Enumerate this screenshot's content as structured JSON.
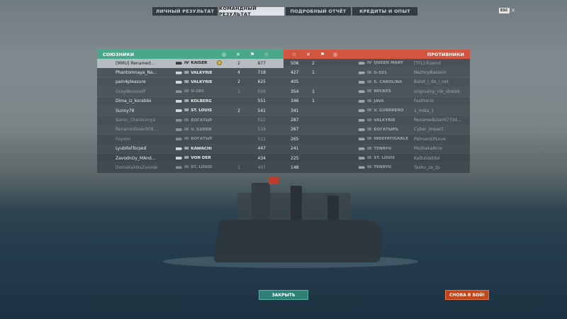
{
  "tabs": [
    {
      "label": "ЛИЧНЫЙ РЕЗУЛЬТАТ"
    },
    {
      "label": "КОМАНДНЫЙ РЕЗУЛЬТАТ"
    },
    {
      "label": "ПОДРОБНЫЙ ОТЧЁТ"
    },
    {
      "label": "КРЕДИТЫ И ОПЫТ"
    }
  ],
  "active_tab": "КОМАНДНЫЙ РЕЗУЛЬТАТ",
  "hotkey": {
    "key": "ESC",
    "close": "×"
  },
  "allies": {
    "title": "СОЮЗНИКИ",
    "header_icons": {
      "medal": "◎",
      "kills": "✕",
      "capture": "⚑",
      "score": "☆"
    },
    "rows": [
      {
        "name": "[MMU] RenamedUser...",
        "tier": "IV",
        "ship": "KAISER",
        "medal": true,
        "kills": "2",
        "cap": "",
        "score": "877",
        "self": true,
        "alive": true
      },
      {
        "name": "Phantomnaya_Nastya",
        "tier": "III",
        "ship": "VALKYRIE",
        "medal": false,
        "kills": "4",
        "cap": "",
        "score": "718",
        "self": false,
        "alive": true
      },
      {
        "name": "pain4pleasure",
        "tier": "III",
        "ship": "VALKYRIE",
        "medal": false,
        "kills": "2",
        "cap": "",
        "score": "625",
        "self": false,
        "alive": true
      },
      {
        "name": "GrayWooooolf",
        "tier": "III",
        "ship": "G-101",
        "medal": false,
        "kills": "1",
        "cap": "",
        "score": "556",
        "self": false,
        "alive": false
      },
      {
        "name": "Dima_iz_korablei",
        "tier": "III",
        "ship": "KOLBERG",
        "medal": false,
        "kills": "",
        "cap": "",
        "score": "551",
        "self": false,
        "alive": true
      },
      {
        "name": "Sunny78",
        "tier": "III",
        "ship": "ST. LOUIS",
        "medal": false,
        "kills": "2",
        "cap": "",
        "score": "541",
        "self": false,
        "alive": true
      },
      {
        "name": "Baron_Cheresnnya",
        "tier": "III",
        "ship": "БОГАТЫРЬ",
        "medal": false,
        "kills": "",
        "cap": "",
        "score": "522",
        "self": false,
        "alive": false
      },
      {
        "name": "RenamedUser9080234",
        "tier": "III",
        "ship": "V. GUERRERO",
        "medal": false,
        "kills": "",
        "cap": "",
        "score": "518",
        "self": false,
        "alive": false
      },
      {
        "name": "Feyxon",
        "tier": "III",
        "ship": "БОГАТЫРЬ",
        "medal": false,
        "kills": "",
        "cap": "",
        "score": "511",
        "self": false,
        "alive": false
      },
      {
        "name": "LyubitelTorped",
        "tier": "III",
        "ship": "KAWACHI",
        "medal": false,
        "kills": "",
        "cap": "",
        "score": "447",
        "self": false,
        "alive": true
      },
      {
        "name": "ZavodnOy_MAndarin",
        "tier": "III",
        "ship": "VON DER TANN",
        "medal": false,
        "kills": "",
        "cap": "",
        "score": "434",
        "self": false,
        "alive": true
      },
      {
        "name": "DomaKakNaZavode",
        "tier": "III",
        "ship": "ST. LOUIS",
        "medal": false,
        "kills": "1",
        "cap": "",
        "score": "407",
        "self": false,
        "alive": false
      }
    ]
  },
  "enemies": {
    "title": "ПРОТИВНИКИ",
    "header_icons": {
      "score": "☆",
      "kills": "✕",
      "capture": "⚑",
      "medal": "◎"
    },
    "rows": [
      {
        "score": "506",
        "kills": "2",
        "cap": "",
        "tier": "IV",
        "ship": "QUEEN MARY",
        "name": "[TFL] Rizerot",
        "alive": true
      },
      {
        "score": "427",
        "kills": "1",
        "cap": "",
        "tier": "III",
        "ship": "G-101",
        "name": "NezhnyBassein",
        "alive": true
      },
      {
        "score": "405",
        "kills": "",
        "cap": "",
        "tier": "III",
        "ship": "S. CAROLINA",
        "name": "Batet_i_da_i_net",
        "alive": true
      },
      {
        "score": "354",
        "kills": "1",
        "cap": "",
        "tier": "III",
        "ship": "WICKES",
        "name": "originalny_nik_strelok",
        "alive": true
      },
      {
        "score": "346",
        "kills": "1",
        "cap": "",
        "tier": "III",
        "ship": "JAVA",
        "name": "FastHeroi",
        "alive": true
      },
      {
        "score": "341",
        "kills": "",
        "cap": "",
        "tier": "III",
        "ship": "V. GUERRERO",
        "name": "1_mika_1",
        "alive": true
      },
      {
        "score": "287",
        "kills": "",
        "cap": "",
        "tier": "III",
        "ship": "VALKYRIE",
        "name": "RenamedUser67734...",
        "alive": true
      },
      {
        "score": "267",
        "kills": "",
        "cap": "",
        "tier": "III",
        "ship": "БОГАТЫРЬ",
        "name": "Cyber_Impact",
        "alive": true
      },
      {
        "score": "265",
        "kills": "",
        "cap": "",
        "tier": "III",
        "ship": "INDEFATIGABLE",
        "name": "PelmeniOfLove",
        "alive": true
      },
      {
        "score": "241",
        "kills": "",
        "cap": "",
        "tier": "III",
        "ship": "TENRYŪ",
        "name": "MozbakaArze",
        "alive": true
      },
      {
        "score": "225",
        "kills": "",
        "cap": "",
        "tier": "III",
        "ship": "ST. LOUIS",
        "name": "KatkaValidol",
        "alive": true
      },
      {
        "score": "148",
        "kills": "",
        "cap": "",
        "tier": "III",
        "ship": "TENRYŪ",
        "name": "Tashu_za_zp",
        "alive": true
      }
    ]
  },
  "buttons": {
    "close": "ЗАКРЫТЬ",
    "battle": "СНОВА В БОЙ!"
  },
  "colors": {
    "ally": "#4aa88a",
    "enemy": "#d1553f",
    "close_btn": "#2f8074",
    "battle_btn": "#c2461c"
  }
}
